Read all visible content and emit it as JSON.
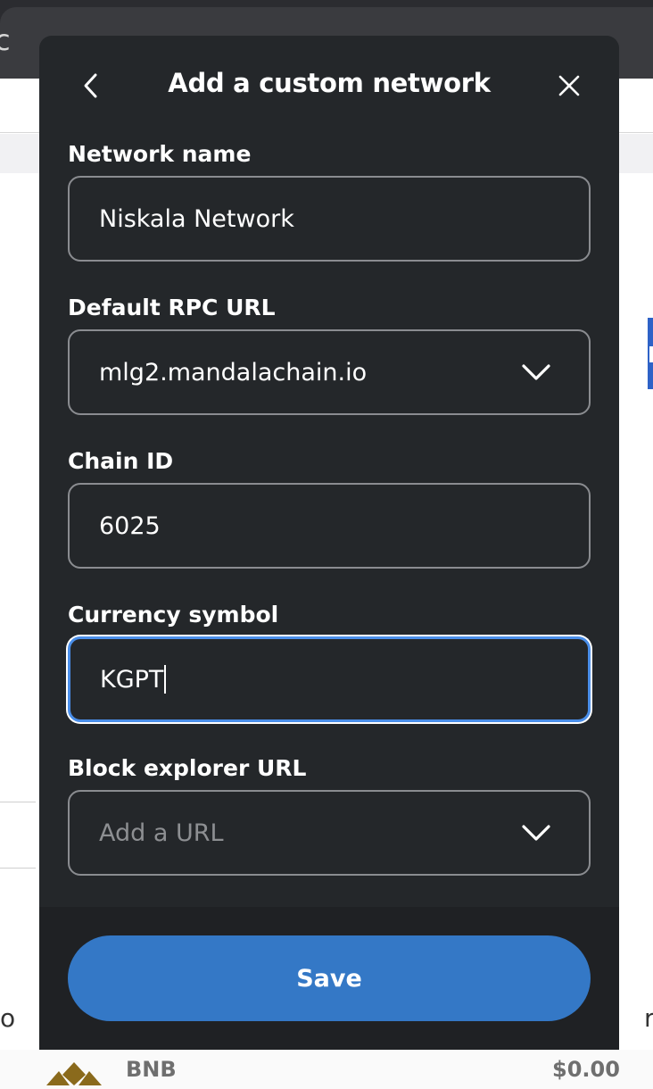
{
  "background": {
    "tab_glyph": "c",
    "left_edge_glyph": "o",
    "right_edge_glyph": "r",
    "token_row": {
      "name": "BNB",
      "value": "$0.00"
    }
  },
  "modal": {
    "title": "Add a custom network",
    "fields": [
      {
        "label": "Network name",
        "value": "Niskala Network",
        "placeholder": ""
      },
      {
        "label": "Default RPC URL",
        "value": "mlg2.mandalachain.io",
        "placeholder": "",
        "dropdown": true
      },
      {
        "label": "Chain ID",
        "value": "6025",
        "placeholder": ""
      },
      {
        "label": "Currency symbol",
        "value": "KGPT",
        "placeholder": "",
        "focused": true
      },
      {
        "label": "Block explorer URL",
        "value": "",
        "placeholder": "Add a URL",
        "dropdown": true
      }
    ],
    "save_label": "Save"
  },
  "colors": {
    "modal_bg": "#24272a",
    "accent": "#3478c6",
    "focus_ring": "#4a8ee9",
    "field_border": "#8a8c90"
  },
  "icons": [
    "chevron-left-icon",
    "close-icon",
    "chevron-down-icon",
    "bnb-token-icon"
  ]
}
